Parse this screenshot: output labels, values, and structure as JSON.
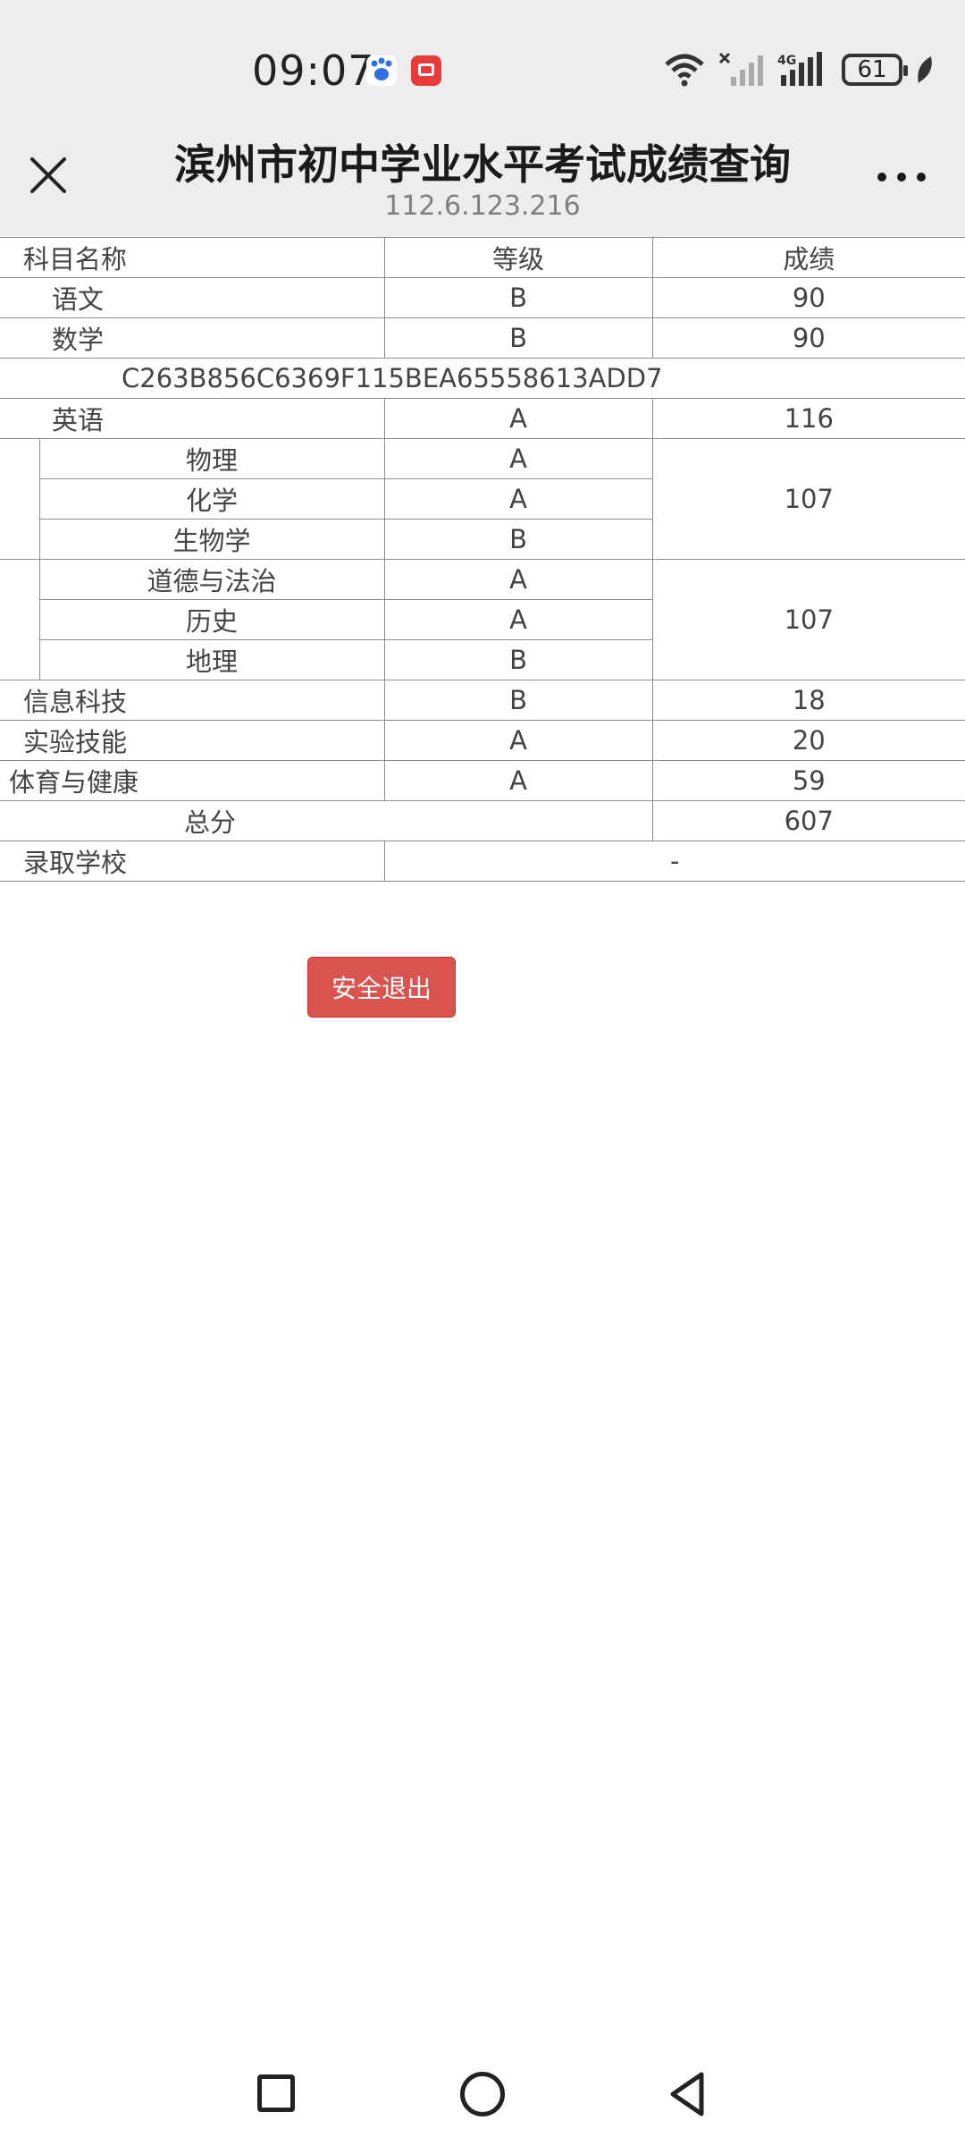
{
  "status_bar": {
    "time": "09:07",
    "battery": "61",
    "icons": [
      "baidu-icon",
      "red-app-icon",
      "wifi-icon",
      "no-sim-signal-icon",
      "4g-signal-icon",
      "battery-icon",
      "leaf-icon"
    ]
  },
  "header": {
    "title": "滨州市初中学业水平考试成绩查询",
    "url": "112.6.123.216",
    "close_icon": "close-icon",
    "more_icon": "more-icon"
  },
  "table": {
    "headers": [
      "科目名称",
      "等级",
      "成绩"
    ],
    "rows": {
      "chinese": {
        "subject": "语文",
        "grade": "B",
        "score": "90"
      },
      "math": {
        "subject": "数学",
        "grade": "B",
        "score": "90"
      },
      "hash": "C263B856C6369F115BEA65558613ADD7",
      "english": {
        "subject": "英语",
        "grade": "A",
        "score": "116"
      },
      "physics": {
        "subject": "物理",
        "grade": "A"
      },
      "chemistry": {
        "subject": "化学",
        "grade": "A"
      },
      "biology": {
        "subject": "生物学",
        "grade": "B"
      },
      "science_score": "107",
      "ethics": {
        "subject": "道德与法治",
        "grade": "A"
      },
      "history": {
        "subject": "历史",
        "grade": "A"
      },
      "geography": {
        "subject": "地理",
        "grade": "B"
      },
      "humanities_score": "107",
      "it": {
        "subject": "信息科技",
        "grade": "B",
        "score": "18"
      },
      "lab": {
        "subject": "实验技能",
        "grade": "A",
        "score": "20"
      },
      "pe": {
        "subject": "体育与健康",
        "grade": "A",
        "score": "59"
      },
      "total": {
        "label": "总分",
        "score": "607"
      },
      "school": {
        "label": "录取学校",
        "value": "-"
      }
    }
  },
  "logout_button": "安全退出",
  "colors": {
    "topbar_bg": "#ededed",
    "button_bg": "#d9534f",
    "border": "#8c8c8c"
  }
}
